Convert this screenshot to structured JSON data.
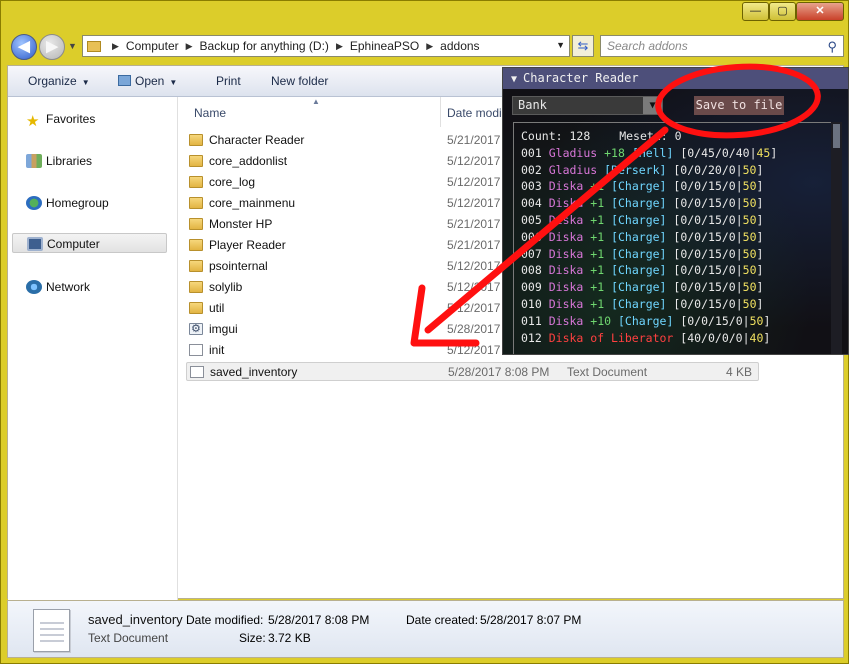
{
  "window": {
    "controls": {
      "minimize": "—",
      "maximize": "▢",
      "close": "✕"
    }
  },
  "nav": {
    "back": "◀",
    "forward": "▶",
    "breadcrumb": [
      "Computer",
      "Backup for anything (D:)",
      "EphineaPSO",
      "addons"
    ],
    "search_placeholder": "Search addons"
  },
  "toolbar": {
    "organize": "Organize",
    "open": "Open",
    "print": "Print",
    "new_folder": "New folder"
  },
  "sidebar": {
    "items": [
      {
        "label": "Favorites",
        "icon": "star-icon"
      },
      {
        "label": "Libraries",
        "icon": "libraries-icon"
      },
      {
        "label": "Homegroup",
        "icon": "homegroup-icon"
      },
      {
        "label": "Computer",
        "icon": "computer-icon"
      },
      {
        "label": "Network",
        "icon": "network-icon"
      }
    ]
  },
  "columns": {
    "name": "Name",
    "date": "Date modi"
  },
  "files": [
    {
      "name": "Character Reader",
      "date": "5/21/2017",
      "type": "",
      "size": "",
      "icon": "folder-icon"
    },
    {
      "name": "core_addonlist",
      "date": "5/12/2017",
      "type": "",
      "size": "",
      "icon": "folder-icon"
    },
    {
      "name": "core_log",
      "date": "5/12/2017",
      "type": "",
      "size": "",
      "icon": "folder-icon"
    },
    {
      "name": "core_mainmenu",
      "date": "5/12/2017",
      "type": "",
      "size": "",
      "icon": "folder-icon"
    },
    {
      "name": "Monster HP",
      "date": "5/21/2017",
      "type": "",
      "size": "",
      "icon": "folder-icon"
    },
    {
      "name": "Player Reader",
      "date": "5/21/2017",
      "type": "",
      "size": "",
      "icon": "folder-icon"
    },
    {
      "name": "psointernal",
      "date": "5/12/2017",
      "type": "",
      "size": "",
      "icon": "folder-icon"
    },
    {
      "name": "solylib",
      "date": "5/12/2017",
      "type": "",
      "size": "",
      "icon": "folder-icon"
    },
    {
      "name": "util",
      "date": "5/12/2017",
      "type": "",
      "size": "",
      "icon": "folder-icon"
    },
    {
      "name": "imgui",
      "date": "5/28/2017",
      "type": "",
      "size": "",
      "icon": "settings-file-icon"
    },
    {
      "name": "init",
      "date": "5/12/2017",
      "type": "",
      "size": "",
      "icon": "text-file-icon"
    },
    {
      "name": "saved_inventory",
      "date": "5/28/2017 8:08 PM",
      "type": "Text Document",
      "size": "4 KB",
      "icon": "text-file-icon"
    }
  ],
  "details": {
    "name": "saved_inventory",
    "type": "Text Document",
    "date_modified_label": "Date modified:",
    "date_modified": "5/28/2017 8:08 PM",
    "size_label": "Size:",
    "size": "3.72 KB",
    "date_created_label": "Date created:",
    "date_created": "5/28/2017 8:07 PM"
  },
  "overlay": {
    "title": "Character Reader",
    "collapse": "▼",
    "dropdown_value": "Bank",
    "dropdown_arrow": "▼",
    "save_button": "Save to file",
    "count_label": "Count:",
    "count": "128",
    "meseta_label": "Meseta:",
    "meseta": "0",
    "items": [
      {
        "id": "001",
        "name": "Gladius",
        "grind": "+18",
        "special": "[Hell]",
        "stats": "[0/45/0/40|",
        "hit": "45",
        "end": "]"
      },
      {
        "id": "002",
        "name": "Gladius",
        "grind": "",
        "special": "[Berserk]",
        "stats": "[0/0/20/0|",
        "hit": "50",
        "end": "]"
      },
      {
        "id": "003",
        "name": "Diska",
        "grind": "+1",
        "special": "[Charge]",
        "stats": "[0/0/15/0|",
        "hit": "50",
        "end": "]"
      },
      {
        "id": "004",
        "name": "Diska",
        "grind": "+1",
        "special": "[Charge]",
        "stats": "[0/0/15/0|",
        "hit": "50",
        "end": "]"
      },
      {
        "id": "005",
        "name": "Diska",
        "grind": "+1",
        "special": "[Charge]",
        "stats": "[0/0/15/0|",
        "hit": "50",
        "end": "]"
      },
      {
        "id": "006",
        "name": "Diska",
        "grind": "+1",
        "special": "[Charge]",
        "stats": "[0/0/15/0|",
        "hit": "50",
        "end": "]"
      },
      {
        "id": "007",
        "name": "Diska",
        "grind": "+1",
        "special": "[Charge]",
        "stats": "[0/0/15/0|",
        "hit": "50",
        "end": "]"
      },
      {
        "id": "008",
        "name": "Diska",
        "grind": "+1",
        "special": "[Charge]",
        "stats": "[0/0/15/0|",
        "hit": "50",
        "end": "]"
      },
      {
        "id": "009",
        "name": "Diska",
        "grind": "+1",
        "special": "[Charge]",
        "stats": "[0/0/15/0|",
        "hit": "50",
        "end": "]"
      },
      {
        "id": "010",
        "name": "Diska",
        "grind": "+1",
        "special": "[Charge]",
        "stats": "[0/0/15/0|",
        "hit": "50",
        "end": "]"
      },
      {
        "id": "011",
        "name": "Diska",
        "grind": "+10",
        "special": "[Charge]",
        "stats": "[0/0/15/0|",
        "hit": "50",
        "end": "]"
      },
      {
        "id": "012",
        "name": "Diska of Liberator",
        "grind": "",
        "special": "",
        "stats": "[40/0/0/0|",
        "hit": "40",
        "end": "]",
        "rare": true
      }
    ]
  },
  "colors": {
    "annotation": "#ff1010",
    "window_frame": "#dccd2a",
    "overlay_title": "#4d4f7a"
  }
}
